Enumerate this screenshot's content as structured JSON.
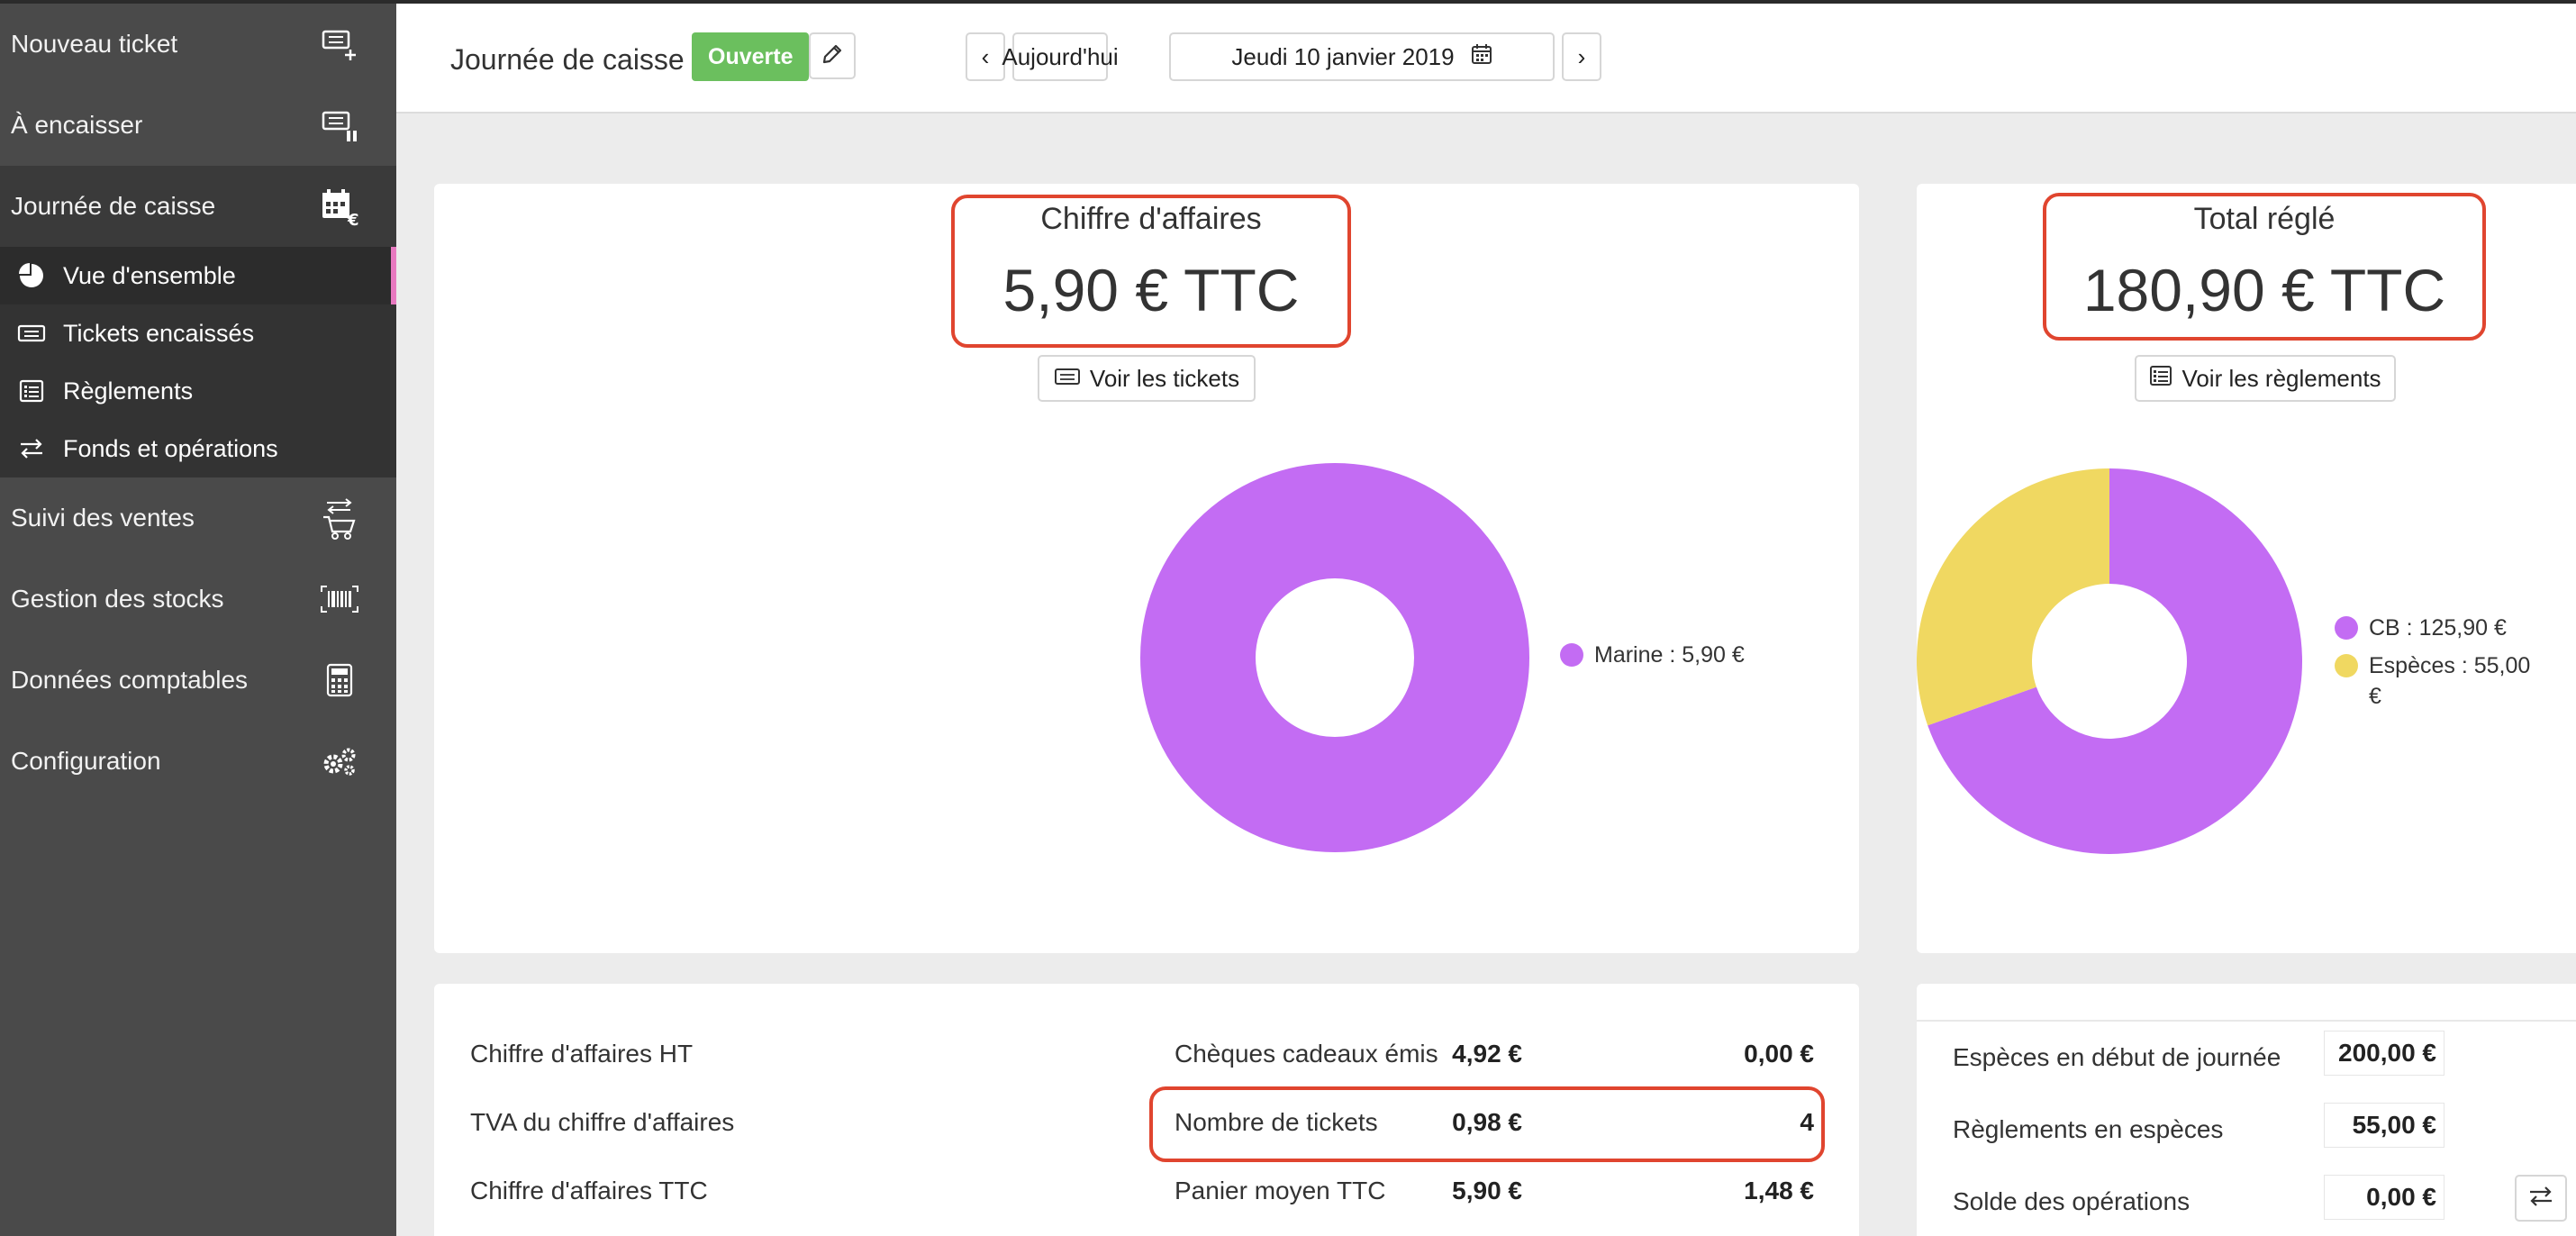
{
  "sidebar": {
    "items": [
      {
        "label": "Nouveau ticket",
        "icon": "ticket-add-icon"
      },
      {
        "label": "À encaisser",
        "icon": "ticket-pause-icon"
      },
      {
        "label": "Journée de caisse",
        "icon": "calendar-euro-icon"
      },
      {
        "label": "Suivi des ventes",
        "icon": "cart-icon"
      },
      {
        "label": "Gestion des stocks",
        "icon": "barcode-icon"
      },
      {
        "label": "Données comptables",
        "icon": "calculator-icon"
      },
      {
        "label": "Configuration",
        "icon": "gears-icon"
      }
    ],
    "subitems": [
      {
        "label": "Vue d'ensemble",
        "icon": "pie-chart-icon"
      },
      {
        "label": "Tickets encaissés",
        "icon": "ticket-icon"
      },
      {
        "label": "Règlements",
        "icon": "list-icon"
      },
      {
        "label": "Fonds et opérations",
        "icon": "swap-icon"
      }
    ]
  },
  "header": {
    "title": "Journée de caisse",
    "status": "Ouverte",
    "prev": "‹",
    "today": "Aujourd'hui",
    "date": "Jeudi 10 janvier 2019",
    "next": "›"
  },
  "revenue": {
    "title": "Chiffre d'affaires",
    "value": "5,90 € TTC",
    "button": "Voir les tickets",
    "legend": [
      {
        "label": "Marine : 5,90 €",
        "color": "#c36cf3"
      }
    ]
  },
  "payments": {
    "title": "Total réglé",
    "value": "180,90 € TTC",
    "button": "Voir les règlements",
    "legend": [
      {
        "label": "CB : 125,90 €",
        "color": "#c36cf3"
      },
      {
        "label": "Espèces : 55,00 €",
        "color": "#f0d861"
      }
    ]
  },
  "chart_data": [
    {
      "type": "pie",
      "categories": [
        "Marine"
      ],
      "values": [
        5.9
      ],
      "colors": [
        "#c36cf3"
      ]
    },
    {
      "type": "pie",
      "categories": [
        "CB",
        "Espèces"
      ],
      "values": [
        125.9,
        55.0
      ],
      "colors": [
        "#c36cf3",
        "#f0d861"
      ]
    }
  ],
  "stats_left": [
    {
      "label": "Chiffre d'affaires HT",
      "value": "4,92 €"
    },
    {
      "label": "TVA du chiffre d'affaires",
      "value": "0,98 €"
    },
    {
      "label": "Chiffre d'affaires TTC",
      "value": "5,90 €"
    }
  ],
  "stats_mid": [
    {
      "label": "Chèques cadeaux émis",
      "value": "0,00 €"
    },
    {
      "label": "Nombre de tickets",
      "value": "4"
    },
    {
      "label": "Panier moyen TTC",
      "value": "1,48 €"
    }
  ],
  "cash": [
    {
      "label": "Espèces en début de journée",
      "value": "200,00 €"
    },
    {
      "label": "Règlements en espèces",
      "value": "55,00 €"
    },
    {
      "label": "Solde des opérations",
      "value": "0,00 €"
    }
  ]
}
